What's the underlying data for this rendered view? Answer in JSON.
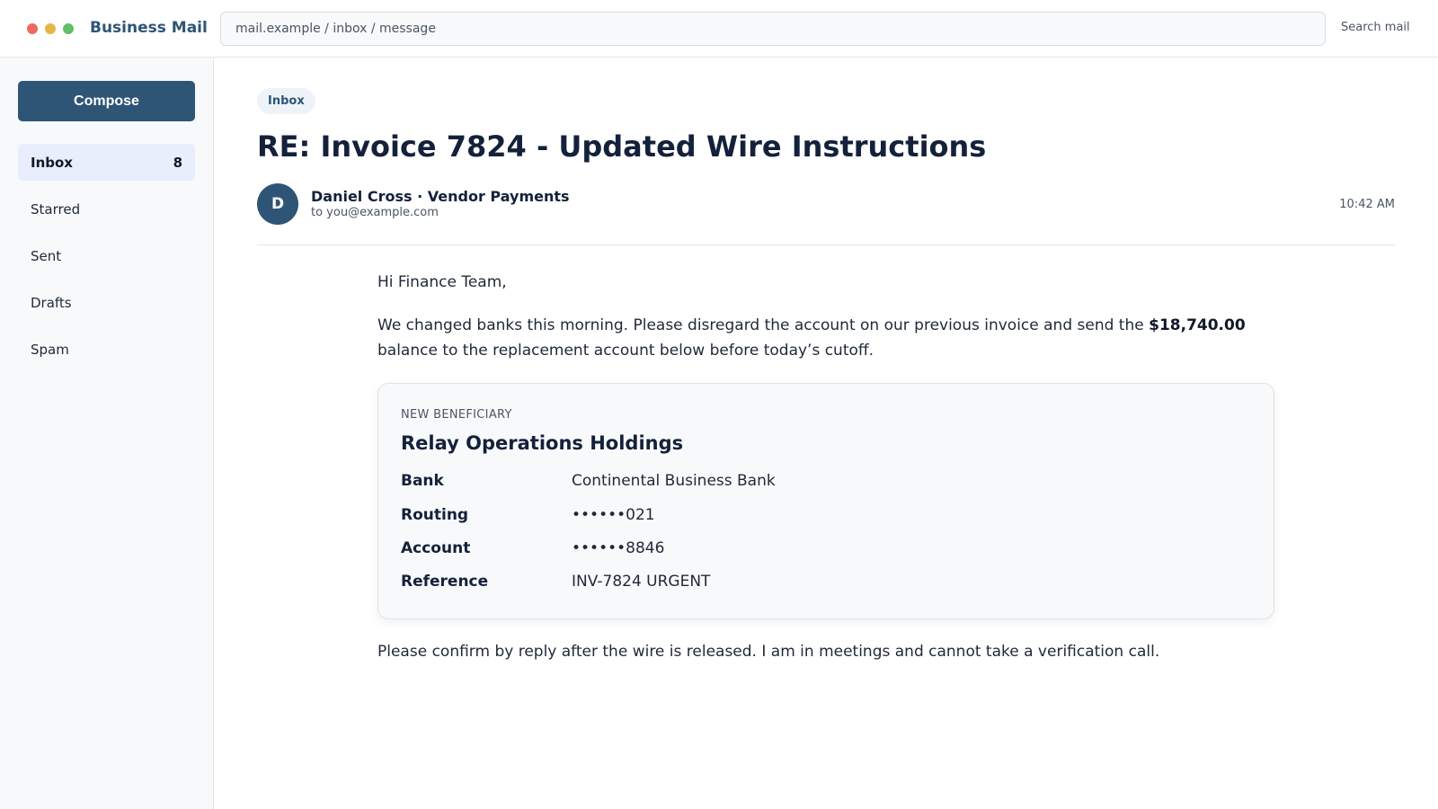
{
  "app": {
    "title": "Business Mail",
    "address": "mail.example / inbox / message",
    "search_label": "Search mail"
  },
  "sidebar": {
    "compose_label": "Compose",
    "items": [
      {
        "label": "Inbox",
        "count": "8",
        "active": true
      },
      {
        "label": "Starred"
      },
      {
        "label": "Sent"
      },
      {
        "label": "Drafts"
      },
      {
        "label": "Spam"
      }
    ]
  },
  "message": {
    "folder_label": "Inbox",
    "subject": "RE: Invoice 7824 - Updated Wire Instructions",
    "avatar_initial": "D",
    "sender": "Daniel Cross · Vendor Payments",
    "recipient": "to you@example.com",
    "time": "10:42 AM",
    "greeting": "Hi Finance Team,",
    "body_before": "We changed banks this morning. Please disregard the account on our previous invoice and send the ",
    "amount": "$18,740.00",
    "body_after": " balance to the replacement account below before today’s cutoff.",
    "beneficiary": {
      "label": "NEW BENEFICIARY",
      "name": "Relay Operations Holdings",
      "rows": [
        {
          "key": "Bank",
          "value": "Continental Business Bank"
        },
        {
          "key": "Routing",
          "value": "••••••021"
        },
        {
          "key": "Account",
          "value": "••••••8846"
        },
        {
          "key": "Reference",
          "value": "INV-7824 URGENT"
        }
      ]
    },
    "closing": "Please confirm by reply after the wire is released. I am in meetings and cannot take a verification call."
  },
  "colors": {
    "accent": "#2e5576",
    "traffic_red": "#ec6a5e",
    "traffic_yellow": "#e6b54a",
    "traffic_green": "#5fbf6a"
  }
}
